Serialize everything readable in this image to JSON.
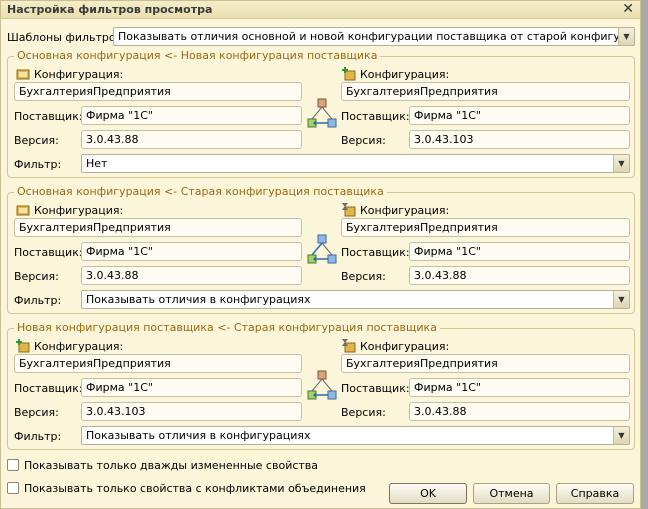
{
  "window": {
    "title": "Настройка фильтров просмотра"
  },
  "templates": {
    "label": "Шаблоны фильтров:",
    "value": "Показывать отличия основной и новой конфигурации поставщика от старой конфигурации постав"
  },
  "labels": {
    "config": "Конфигурация:",
    "vendor": "Поставщик:",
    "version": "Версия:",
    "filter": "Фильтр:"
  },
  "groups": [
    {
      "title": "Основная конфигурация <- Новая конфигурация поставщика",
      "left": {
        "config": "БухгалтерияПредприятия",
        "vendor": "Фирма \"1С\"",
        "version": "3.0.43.88"
      },
      "right": {
        "config": "БухгалтерияПредприятия",
        "vendor": "Фирма \"1С\"",
        "version": "3.0.43.103"
      },
      "filter": "Нет"
    },
    {
      "title": "Основная конфигурация <- Старая конфигурация поставщика",
      "left": {
        "config": "БухгалтерияПредприятия",
        "vendor": "Фирма \"1С\"",
        "version": "3.0.43.88"
      },
      "right": {
        "config": "БухгалтерияПредприятия",
        "vendor": "Фирма \"1С\"",
        "version": "3.0.43.88"
      },
      "filter": "Показывать отличия в конфигурациях"
    },
    {
      "title": "Новая конфигурация поставщика <- Старая конфигурация поставщика",
      "left": {
        "config": "БухгалтерияПредприятия",
        "vendor": "Фирма \"1С\"",
        "version": "3.0.43.103"
      },
      "right": {
        "config": "БухгалтерияПредприятия",
        "vendor": "Фирма \"1С\"",
        "version": "3.0.43.88"
      },
      "filter": "Показывать отличия в конфигурациях"
    }
  ],
  "options": {
    "twice_changed": "Показывать только дважды измененные свойства",
    "merge_conflicts": "Показывать только свойства с конфликтами объединения"
  },
  "buttons": {
    "ok": "OK",
    "cancel": "Отмена",
    "help": "Справка"
  }
}
